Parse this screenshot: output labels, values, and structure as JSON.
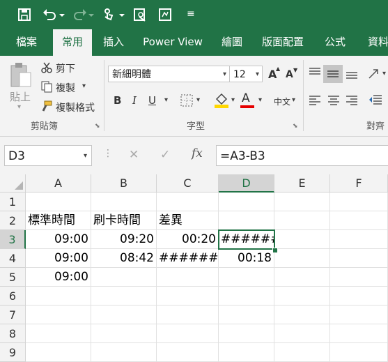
{
  "quick_access": {
    "more": "≡"
  },
  "tabs": [
    "檔案",
    "常用",
    "插入",
    "Power View",
    "繪圖",
    "版面配置",
    "公式",
    "資料"
  ],
  "ribbon": {
    "clipboard": {
      "paste": "貼上",
      "cut": "剪下",
      "copy": "複製",
      "format_painter": "複製格式",
      "group_label": "剪貼簿"
    },
    "font": {
      "font_name": "新細明體",
      "font_size": "12",
      "group_label": "字型",
      "bold": "B",
      "italic": "I",
      "underline": "U",
      "grow": "A",
      "shrink": "A",
      "color_a": "A",
      "phonetic": "中文"
    },
    "align_group_label": "對齊"
  },
  "formula_bar": {
    "name_box": "D3",
    "cancel": "✕",
    "enter": "✓",
    "fx": "fx",
    "formula": "=A3-B3"
  },
  "columns": [
    "A",
    "B",
    "C",
    "D",
    "E",
    "F"
  ],
  "rows": [
    "1",
    "2",
    "3",
    "4",
    "5",
    "6",
    "7",
    "8",
    "9"
  ],
  "cells": {
    "A2": "標準時間",
    "B2": "刷卡時間",
    "C2": "差異",
    "A3": "09:00",
    "B3": "09:20",
    "C3": "00:20",
    "D3": "#######",
    "A4": "09:00",
    "B4": "08:42",
    "C4": "########",
    "D4": "00:18",
    "A5": "09:00"
  },
  "colors": {
    "accent": "#217346",
    "selection": "#217346"
  }
}
